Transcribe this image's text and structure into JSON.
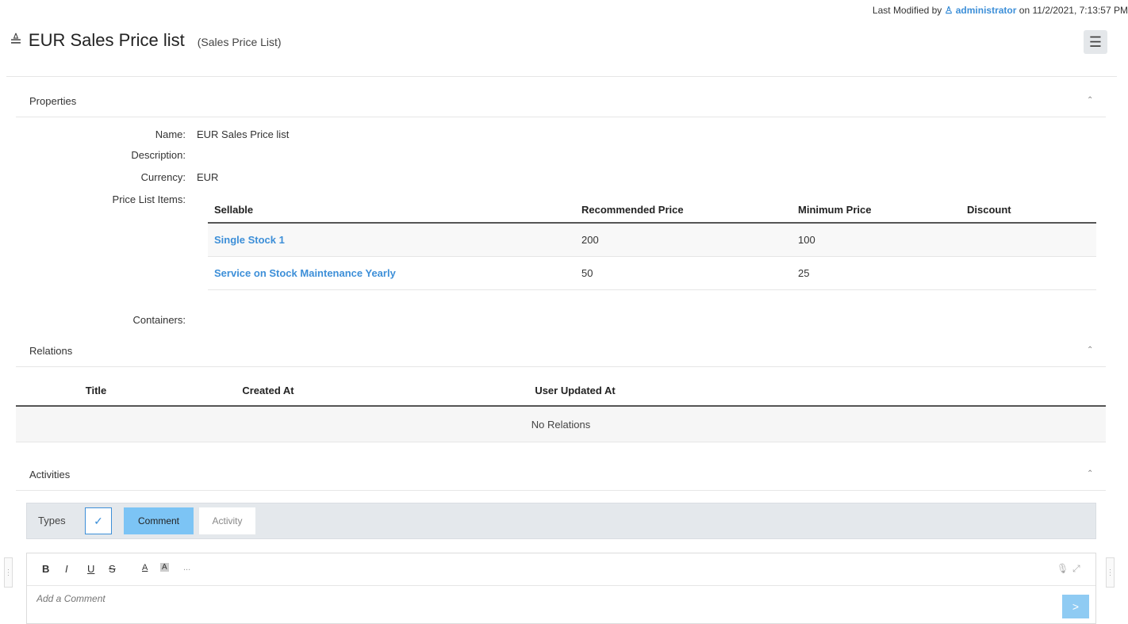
{
  "header": {
    "last_modified_prefix": "Last Modified by ",
    "last_modified_user": "administrator",
    "last_modified_suffix": " on 11/2/2021, 7:13:57 PM",
    "title": "EUR Sales Price list",
    "subtitle": "(Sales Price List)",
    "menu_icon": "☰",
    "title_icon": "≜",
    "user_icon": "♙"
  },
  "properties": {
    "section_title": "Properties",
    "collapse_icon": "⌃",
    "name_label": "Name:",
    "name_value": "EUR Sales Price list",
    "description_label": "Description:",
    "description_value": "",
    "currency_label": "Currency:",
    "currency_value": "EUR",
    "items_label": "Price List Items:",
    "containers_label": "Containers:",
    "items_table": {
      "headers": [
        "Sellable",
        "Recommended Price",
        "Minimum Price",
        "Discount"
      ],
      "rows": [
        {
          "sellable": "Single Stock 1",
          "recommended": "200",
          "minimum": "100",
          "discount": ""
        },
        {
          "sellable": "Service on Stock Maintenance Yearly",
          "recommended": "50",
          "minimum": "25",
          "discount": ""
        }
      ]
    }
  },
  "relations": {
    "section_title": "Relations",
    "collapse_icon": "⌃",
    "headers": [
      "Title",
      "Created At",
      "User Updated At"
    ],
    "empty_text": "No Relations"
  },
  "activities": {
    "section_title": "Activities",
    "collapse_icon": "⌃",
    "types_label": "Types",
    "check_icon": "✓",
    "type_comment": "Comment",
    "type_activity": "Activity",
    "toolbar": {
      "bold": "B",
      "italic": "I",
      "underline": "U",
      "strike": "S",
      "font_color": "A",
      "bg_color": "A",
      "more": "...",
      "mic_icon": "🎙",
      "expand_icon": "⤢"
    },
    "comment_placeholder": "Add a Comment",
    "send_icon": ">",
    "handle_icon": "⋮"
  },
  "colors": {
    "link": "#3d8fd8",
    "comment_type_active": "#7cc4f5",
    "types_bar_bg": "#e4e8ec"
  }
}
